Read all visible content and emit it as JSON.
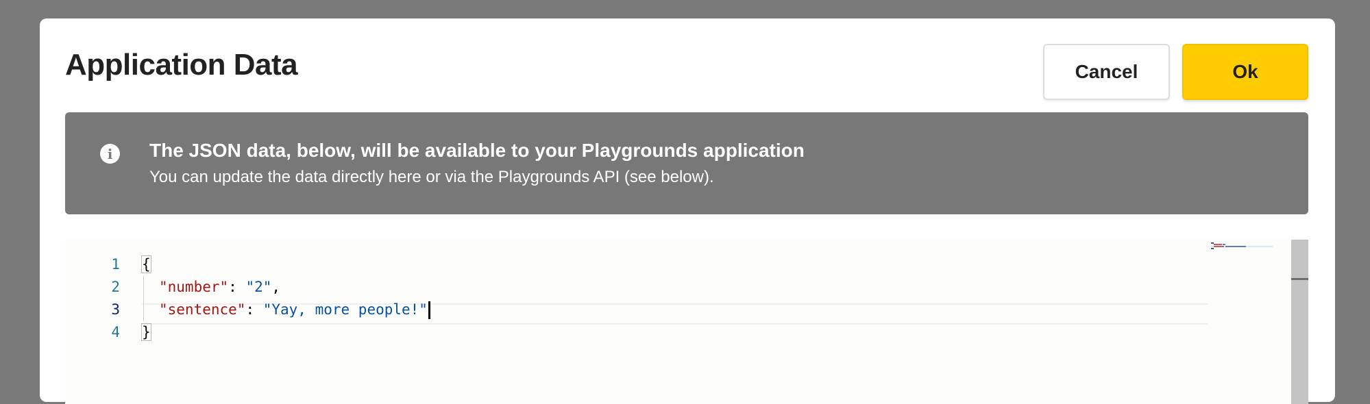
{
  "dialog": {
    "title": "Application Data",
    "cancel_label": "Cancel",
    "ok_label": "Ok"
  },
  "banner": {
    "icon": "info-icon",
    "icon_glyph": "i",
    "heading": "The JSON data, below, will be available to your Playgrounds application",
    "subtext": "You can update the data directly here or via the Playgrounds API (see below)."
  },
  "editor": {
    "line_numbers": [
      "1",
      "2",
      "3",
      "4"
    ],
    "current_line": "3",
    "lines": {
      "l1_open": "{",
      "l2_key": "\"number\"",
      "l2_sep": ": ",
      "l2_value": "\"2\"",
      "l2_comma": ",",
      "l3_key": "\"sentence\"",
      "l3_sep": ": ",
      "l3_value": "\"Yay, more people!\"",
      "l4_close": "}"
    }
  },
  "colors": {
    "overlay": "#7a7a7a",
    "ok_button": "#ffcc00",
    "banner": "#787878",
    "json_key": "#a31515",
    "json_string": "#0451a5",
    "line_number": "#237893"
  }
}
